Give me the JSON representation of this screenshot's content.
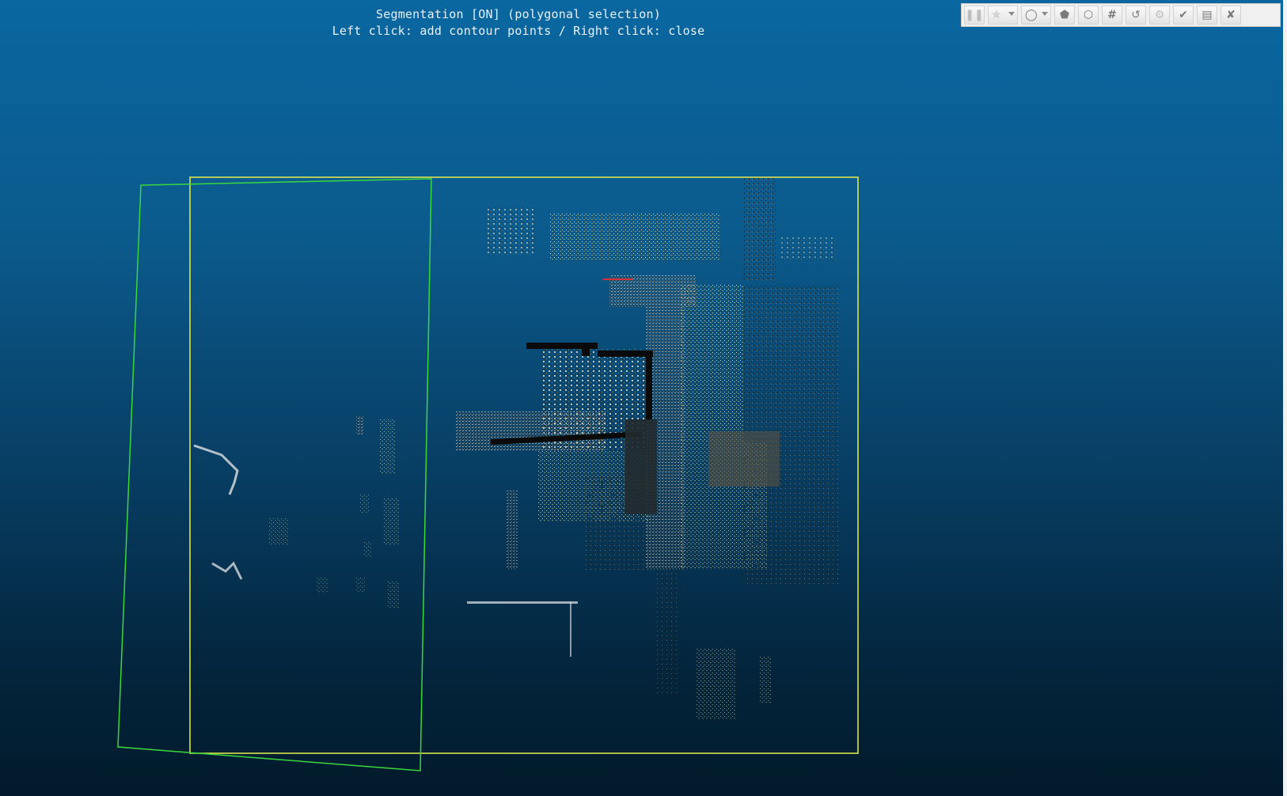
{
  "overlay": {
    "line1": "Segmentation [ON] (polygonal selection)",
    "line2": "Left click: add contour points / Right click: close"
  },
  "toolbar": {
    "buttons": [
      {
        "name": "pause",
        "icon": "pause-icon",
        "glyph": "⏸"
      },
      {
        "name": "selection-mode",
        "icon": "star-select-icon",
        "glyph": "☆"
      },
      {
        "name": "polygon-mode",
        "icon": "circle-select-icon",
        "glyph": "◯"
      },
      {
        "name": "segment-in",
        "icon": "pentagon-in-icon",
        "glyph": "⬟"
      },
      {
        "name": "segment-out",
        "icon": "pentagon-out-icon",
        "glyph": "⬡"
      },
      {
        "name": "export-hash",
        "icon": "hash-icon",
        "glyph": "#"
      },
      {
        "name": "reset",
        "icon": "reset-icon",
        "glyph": "↺"
      },
      {
        "name": "options",
        "icon": "gear-icon",
        "glyph": "⚙"
      },
      {
        "name": "confirm",
        "icon": "check-icon",
        "glyph": "✔"
      },
      {
        "name": "confirm-delete",
        "icon": "trash-icon",
        "glyph": "🗑"
      },
      {
        "name": "cancel",
        "icon": "close-icon",
        "glyph": "✘"
      }
    ]
  },
  "colors": {
    "bg_top": "#0a67a0",
    "bg_bottom": "#021a2b",
    "bbox_yellow": "#e8f04a",
    "polygon_green": "#3ad83a"
  }
}
